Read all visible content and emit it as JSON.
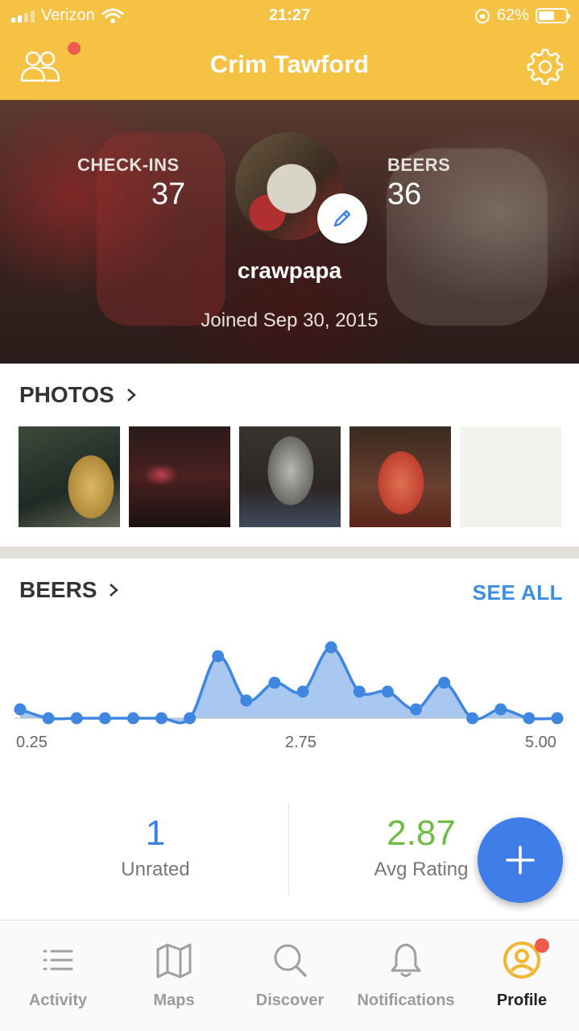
{
  "status_bar": {
    "carrier": "Verizon",
    "time": "21:27",
    "battery": "62%",
    "battery_level": 0.62
  },
  "nav": {
    "title": "Crim Tawford"
  },
  "profile": {
    "checkins_label": "CHECK-INS",
    "checkins_value": "37",
    "beers_label": "BEERS",
    "beers_value": "36",
    "username": "crawpapa",
    "joined": "Joined Sep 30, 2015"
  },
  "photos_section": {
    "title": "PHOTOS"
  },
  "beers_section": {
    "title": "BEERS",
    "see_all": "SEE ALL"
  },
  "chart_data": {
    "type": "area",
    "x": [
      0.25,
      0.5,
      0.75,
      1.0,
      1.25,
      1.5,
      1.75,
      2.0,
      2.25,
      2.5,
      2.75,
      3.0,
      3.25,
      3.5,
      3.75,
      4.0,
      4.25,
      4.5,
      4.75,
      5.0
    ],
    "values": [
      1,
      0,
      0,
      0,
      0,
      0,
      0,
      7,
      2,
      4,
      3,
      8,
      3,
      3,
      1,
      4,
      0,
      1,
      0,
      0
    ],
    "tick_labels": [
      "0.25",
      "2.75",
      "5.00"
    ],
    "ylim": [
      0,
      8
    ],
    "color": "#3f86e0",
    "grid": false
  },
  "stats": {
    "unrated_value": "1",
    "unrated_label": "Unrated",
    "avg_value": "2.87",
    "avg_label": "Avg Rating",
    "unrated_color": "#3b82e0",
    "avg_color": "#6dbd45"
  },
  "tabs": [
    {
      "label": "Activity",
      "icon": "list-icon"
    },
    {
      "label": "Maps",
      "icon": "map-icon"
    },
    {
      "label": "Discover",
      "icon": "search-icon"
    },
    {
      "label": "Notifications",
      "icon": "bell-icon"
    },
    {
      "label": "Profile",
      "icon": "profile-icon"
    }
  ]
}
